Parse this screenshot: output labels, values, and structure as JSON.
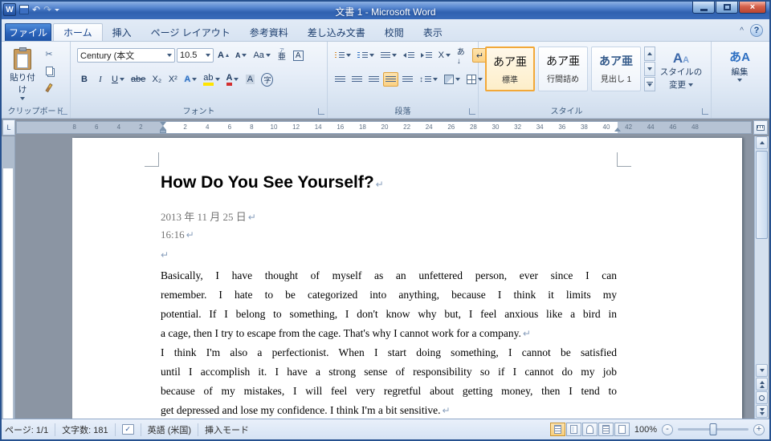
{
  "window": {
    "title": "文書 1 - Microsoft Word",
    "app_icon": "W",
    "close_glyph": "×"
  },
  "qat": {
    "undo": "↶",
    "redo": "↷"
  },
  "tabs": {
    "file": "ファイル",
    "items": [
      {
        "label": "ホーム",
        "active": true
      },
      {
        "label": "挿入"
      },
      {
        "label": "ページ レイアウト"
      },
      {
        "label": "参考資料"
      },
      {
        "label": "差し込み文書"
      },
      {
        "label": "校閲"
      },
      {
        "label": "表示"
      }
    ],
    "minimize": "^",
    "help": "?"
  },
  "ribbon": {
    "clipboard": {
      "label": "クリップボード",
      "paste": "貼り付け",
      "cut_glyph": "✂"
    },
    "font": {
      "label": "フォント",
      "family": "Century (本文",
      "size": "10.5",
      "grow": "A",
      "shrink": "A",
      "case": "Aa",
      "ruby_top": "ア",
      "ruby_base": "亜",
      "boxed": "A",
      "bold": "B",
      "italic": "I",
      "underline": "U",
      "strike": "abe",
      "subscript": "X₂",
      "superscript": "X²",
      "effects": "A",
      "highlight": "ab",
      "color": "A",
      "shading": "A",
      "enclose": "字"
    },
    "paragraph": {
      "label": "段落",
      "ext": "X",
      "sort": "あ↓",
      "marks": "↵",
      "spacing": "↕"
    },
    "styles": {
      "label": "スタイル",
      "items": [
        {
          "preview": "あア亜",
          "name": "標準",
          "selected": true
        },
        {
          "preview": "あア亜",
          "name": "行間詰め",
          "selected": false
        },
        {
          "preview": "あア亜",
          "name": "見出し 1",
          "selected": false
        }
      ],
      "change_line1": "スタイルの",
      "change_line2": "変更",
      "change_icon": "A"
    },
    "editing": {
      "label": "編集",
      "icon": "あA"
    }
  },
  "ruler": {
    "tab_selector": "L",
    "left_numbers": [
      "8",
      "6",
      "4",
      "2"
    ],
    "main_numbers": [
      "2",
      "4",
      "6",
      "8",
      "10",
      "12",
      "14",
      "16",
      "18",
      "20",
      "22",
      "24",
      "26",
      "28",
      "30",
      "32",
      "34",
      "36",
      "38",
      "40",
      "42",
      "44",
      "46",
      "48"
    ]
  },
  "document": {
    "heading": "How Do You See Yourself?",
    "date": "2013 年 11 月 25 日",
    "time": "16:16",
    "mark": "↵",
    "body_lines": [
      {
        "text": "Basically, I have thought of myself as an unfettered person, ever since I can",
        "mark": false
      },
      {
        "text": "remember. I hate to be categorized into anything, because I think it limits my",
        "mark": false
      },
      {
        "text": "potential. If I belong to something, I don't know why but, I feel anxious like a bird in",
        "mark": false
      },
      {
        "text": "a cage, then I try to escape from the cage. That's why I cannot work for a company.",
        "mark": true
      },
      {
        "text": "I think I'm also a perfectionist. When I start doing something, I cannot be satisfied",
        "mark": false
      },
      {
        "text": "until I accomplish it. I have a strong sense of responsibility so if I cannot do my job",
        "mark": false
      },
      {
        "text": "because of my mistakes, I will feel very regretful about getting money, then I tend to",
        "mark": false
      },
      {
        "text": "get depressed and lose my confidence. I think I'm a bit sensitive.",
        "mark": true
      }
    ]
  },
  "statusbar": {
    "page": "ページ: 1/1",
    "chars": "文字数: 181",
    "spell_glyph": "✓",
    "language": "英語 (米国)",
    "mode": "挿入モード",
    "zoom": "100%",
    "zoom_out": "-",
    "zoom_in": "+"
  }
}
